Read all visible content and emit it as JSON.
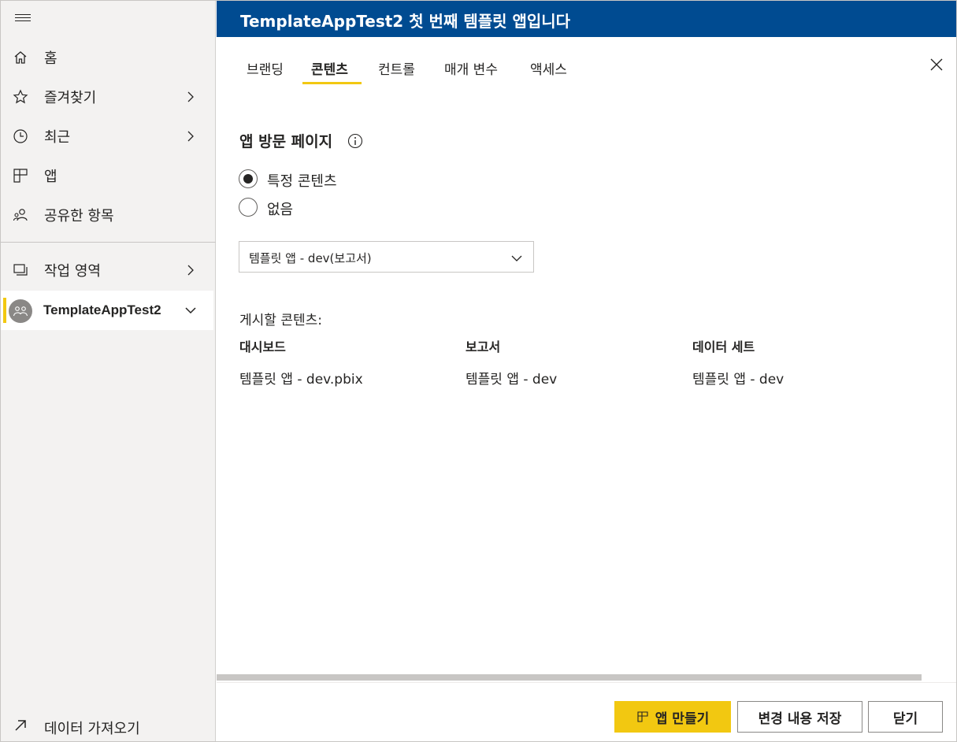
{
  "header": {
    "title": "TemplateAppTest2  첫 번째 템플릿 앱입니다"
  },
  "sidebar": {
    "items": [
      {
        "label": "홈",
        "icon": "home-icon"
      },
      {
        "label": "즐겨찾기",
        "icon": "star-icon"
      },
      {
        "label": "최근",
        "icon": "clock-icon"
      },
      {
        "label": "앱",
        "icon": "apps-icon"
      },
      {
        "label": "공유한 항목",
        "icon": "shared-icon"
      }
    ],
    "workspaces_label": "작업 영역",
    "active_workspace": "TemplateAppTest2",
    "get_data_label": "데이터 가져오기"
  },
  "tabs": [
    {
      "label": "브랜딩",
      "active": false
    },
    {
      "label": "콘텐츠",
      "active": true
    },
    {
      "label": "컨트롤",
      "active": false
    },
    {
      "label": "매개 변수",
      "active": false
    },
    {
      "label": "액세스",
      "active": false
    }
  ],
  "content": {
    "section_title": "앱 방문 페이지",
    "radio_specific": "특정 콘텐츠",
    "radio_none": "없음",
    "selected_option": "특정 콘텐츠",
    "dropdown_value": "템플릿 앱 - dev(보고서)",
    "publish_label": "게시할 콘텐츠:",
    "columns": [
      {
        "header": "대시보드",
        "value": "템플릿 앱 - dev.pbix"
      },
      {
        "header": "보고서",
        "value": "템플릿 앱 - dev"
      },
      {
        "header": "데이터 세트",
        "value": "템플릿 앱 - dev"
      }
    ]
  },
  "footer": {
    "create_app": "앱 만들기",
    "save_changes": "변경 내용 저장",
    "close": "닫기"
  },
  "colors": {
    "header_bg": "#004b91",
    "accent": "#f2c811",
    "sidebar_bg": "#f3f2f1"
  }
}
